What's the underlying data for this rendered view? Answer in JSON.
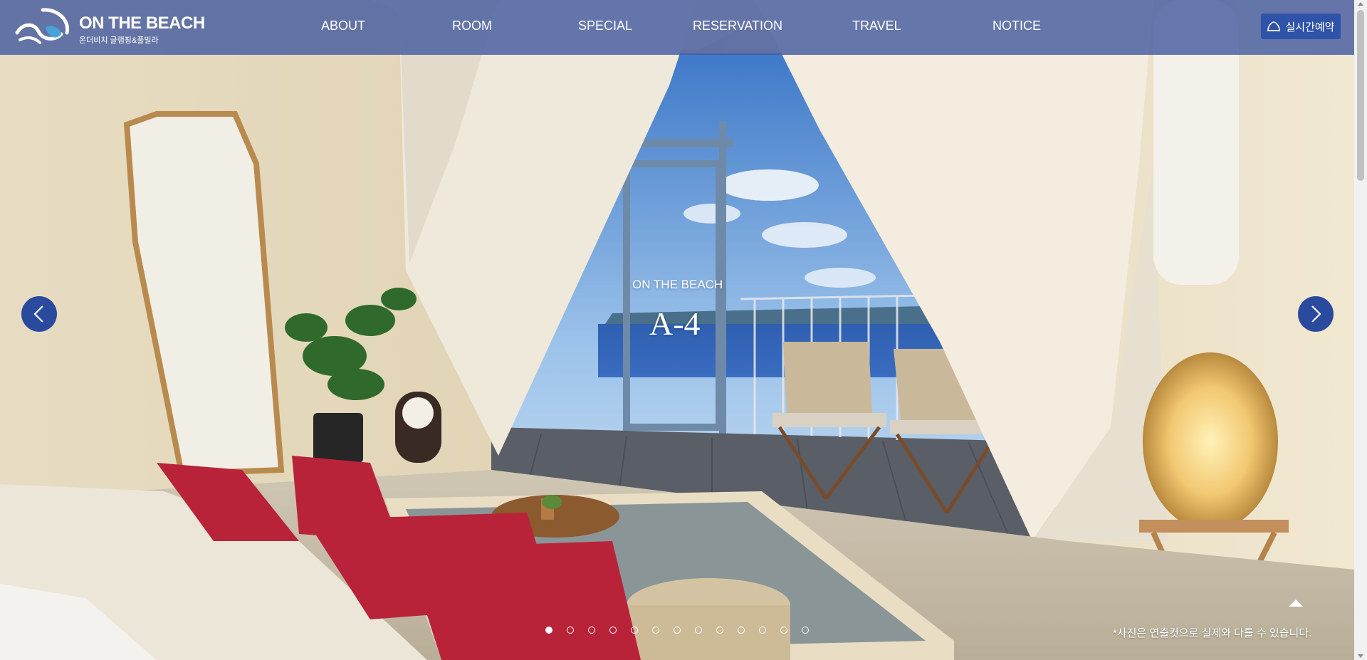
{
  "brand": {
    "title": "ON THE BEACH",
    "subtitle": "온더비치 글램핑&풀빌라"
  },
  "nav": {
    "items": [
      {
        "label": "ABOUT"
      },
      {
        "label": "ROOM"
      },
      {
        "label": "SPECIAL"
      },
      {
        "label": "RESERVATION"
      },
      {
        "label": "TRAVEL"
      },
      {
        "label": "NOTICE"
      }
    ]
  },
  "reserve_button": {
    "label": "실시간예약",
    "icon": "tent-icon"
  },
  "hero": {
    "brand": "ON THE BEACH",
    "room": "A-4",
    "disclaimer": "*사진은 연출컷으로 실제와 다를 수 있습니다.",
    "slide_count": 13,
    "active_slide": 1
  },
  "colors": {
    "header_bg": "#465ca0",
    "accent": "#2a4a9e",
    "button_bg": "#2f53a8"
  }
}
